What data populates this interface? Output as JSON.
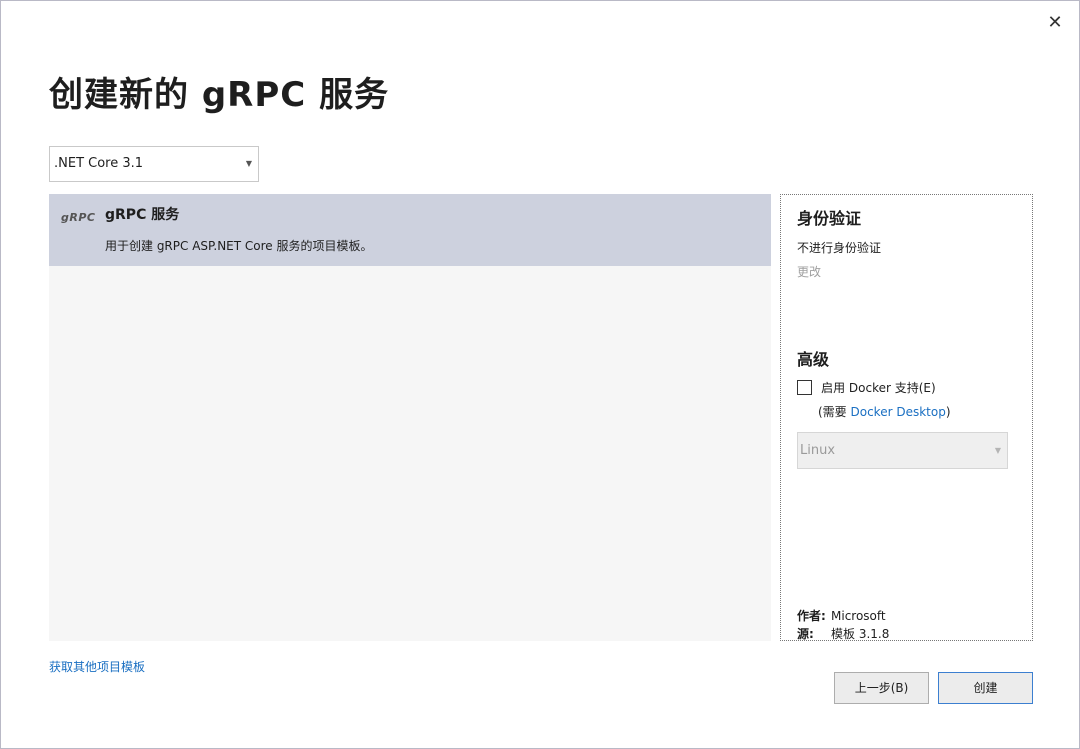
{
  "dialog": {
    "title": "创建新的 gRPC 服务",
    "close_glyph": "✕"
  },
  "framework_select": {
    "value": ".NET Core 3.1",
    "caret": "▼"
  },
  "templates": [
    {
      "logo_text": "gRPC",
      "name": "gRPC 服务",
      "description": "用于创建 gRPC ASP.NET Core 服务的项目模板。"
    }
  ],
  "details": {
    "auth": {
      "title": "身份验证",
      "value": "不进行身份验证",
      "change_label": "更改"
    },
    "advanced": {
      "title": "高级",
      "docker_label": "启用 Docker 支持(E)",
      "docker_note_prefix": "(需要 ",
      "docker_note_link": "Docker Desktop",
      "docker_note_suffix": ")",
      "os_value": "Linux",
      "os_caret": "▼"
    },
    "meta": {
      "author_key": "作者:",
      "author_value": "Microsoft",
      "source_key": "源:",
      "source_value": "模板 3.1.8"
    }
  },
  "footer": {
    "get_more_link": "获取其他项目模板",
    "back_label": "上一步(B)",
    "create_label": "创建"
  },
  "colors": {
    "selected_item_bg": "#cdd1de",
    "link": "#1a6fc2",
    "list_bg": "#f6f6f6"
  }
}
